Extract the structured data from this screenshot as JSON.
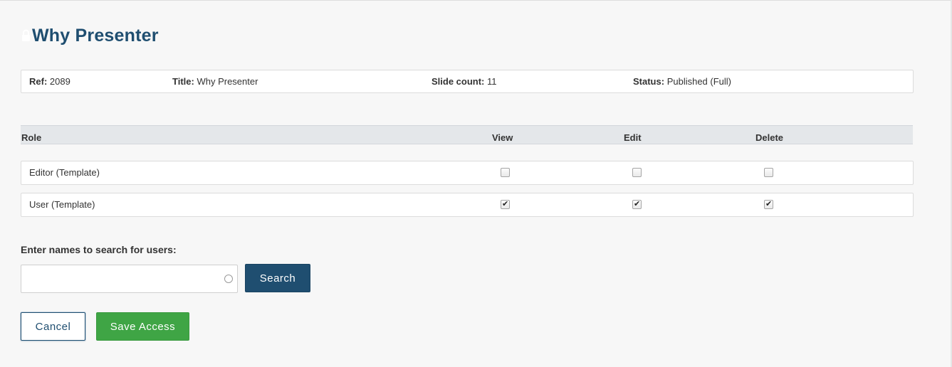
{
  "page": {
    "title": "Why Presenter"
  },
  "info": {
    "ref_label": "Ref:",
    "ref_value": "2089",
    "title_label": "Title:",
    "title_value": "Why Presenter",
    "slide_count_label": "Slide count:",
    "slide_count_value": "11",
    "status_label": "Status:",
    "status_value": "Published (Full)"
  },
  "table": {
    "headers": [
      "Role",
      "View",
      "Edit",
      "Delete"
    ],
    "rows": [
      {
        "role": "Editor (Template)",
        "view": false,
        "edit": false,
        "delete": false
      },
      {
        "role": "User (Template)",
        "view": true,
        "edit": true,
        "delete": true
      }
    ]
  },
  "search": {
    "label": "Enter names to search for users:",
    "value": "",
    "placeholder": "",
    "button_label": "Search"
  },
  "actions": {
    "cancel_label": "Cancel",
    "save_label": "Save Access"
  },
  "icons": {
    "title_icon": "lock-icon",
    "input_icon": "loading-spinner-icon"
  },
  "colors": {
    "primary": "#1f4e70",
    "success": "#3fa545",
    "header_bg": "#e4e7ea",
    "page_bg": "#f7f7f7"
  }
}
